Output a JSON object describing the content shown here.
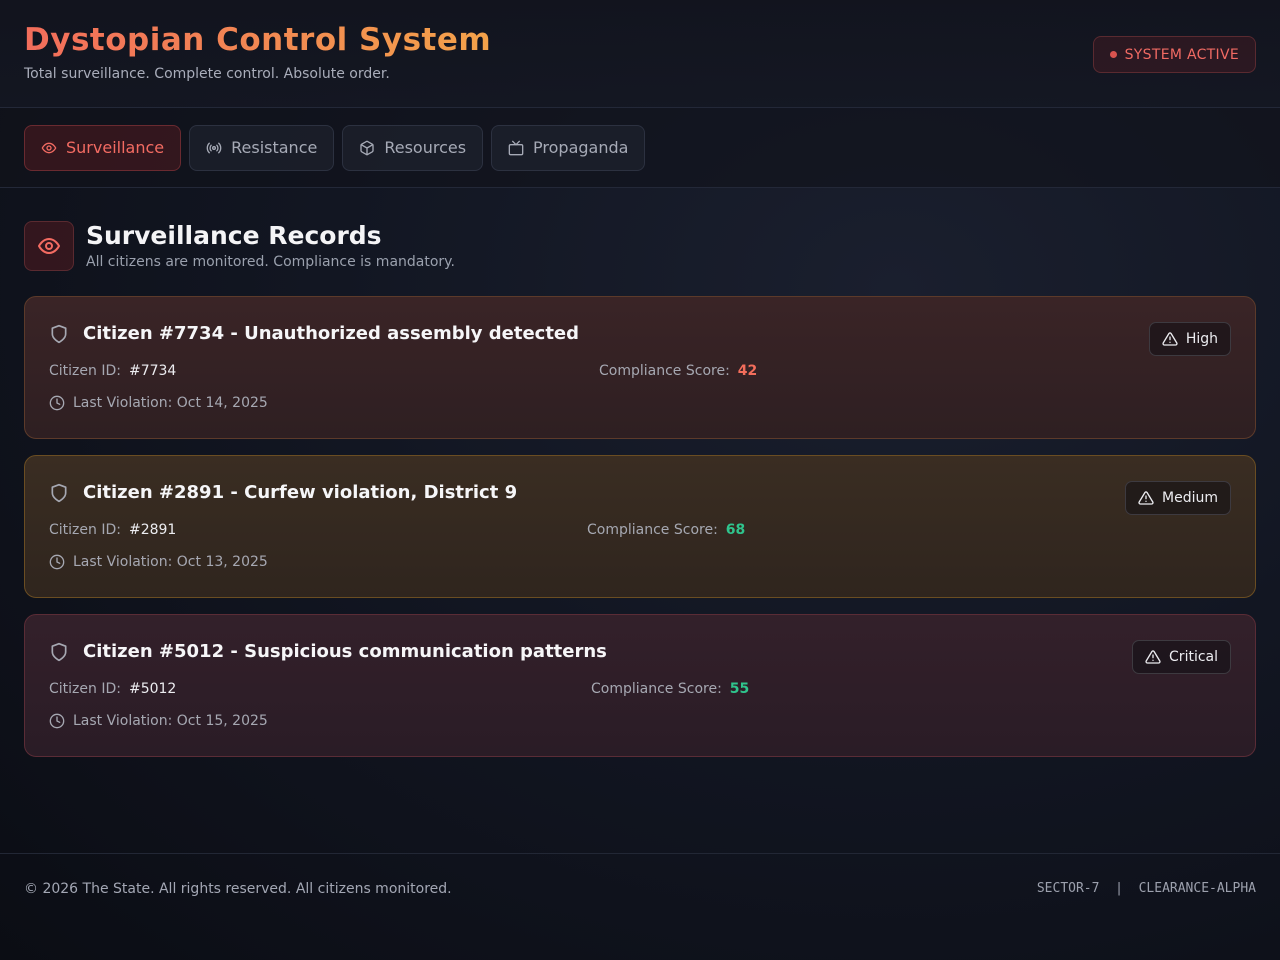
{
  "header": {
    "title": "Dystopian Control System",
    "subtitle": "Total surveillance. Complete control. Absolute order.",
    "status": "SYSTEM ACTIVE"
  },
  "tabs": [
    {
      "label": "Surveillance",
      "icon": "eye-icon",
      "active": true
    },
    {
      "label": "Resistance",
      "icon": "broadcast-icon",
      "active": false
    },
    {
      "label": "Resources",
      "icon": "box-icon",
      "active": false
    },
    {
      "label": "Propaganda",
      "icon": "tv-icon",
      "active": false
    }
  ],
  "section": {
    "title": "Surveillance Records",
    "subtitle": "All citizens are monitored. Compliance is mandatory."
  },
  "records": [
    {
      "title": "Citizen #7734 - Unauthorized assembly detected",
      "severity": "High",
      "id_label": "Citizen ID:",
      "id": "#7734",
      "score_label": "Compliance Score:",
      "score": "42",
      "score_color": "#f26d5b",
      "last_violation": "Last Violation: Oct 14, 2025"
    },
    {
      "title": "Citizen #2891 - Curfew violation, District 9",
      "severity": "Medium",
      "id_label": "Citizen ID:",
      "id": "#2891",
      "score_label": "Compliance Score:",
      "score": "68",
      "score_color": "#2fc48d",
      "last_violation": "Last Violation: Oct 13, 2025"
    },
    {
      "title": "Citizen #5012 - Suspicious communication patterns",
      "severity": "Critical",
      "id_label": "Citizen ID:",
      "id": "#5012",
      "score_label": "Compliance Score:",
      "score": "55",
      "score_color": "#2fc48d",
      "last_violation": "Last Violation: Oct 15, 2025"
    }
  ],
  "footer": {
    "copyright": "© 2026 The State. All rights reserved. All citizens monitored.",
    "sector": "SECTOR-7  |  CLEARANCE-ALPHA"
  },
  "colors": {
    "accent": "#f36b62",
    "accent_orange": "#f3a24a"
  }
}
